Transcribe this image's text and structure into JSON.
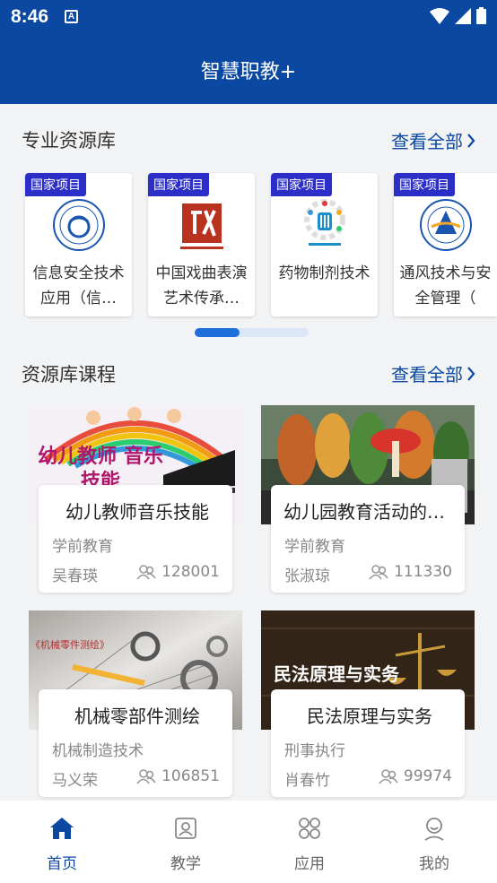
{
  "status": {
    "time": "8:46",
    "notify_letter": "A"
  },
  "header": {
    "title": "智慧职教+"
  },
  "resource_section": {
    "title": "专业资源库",
    "see_all": "查看全部",
    "items": [
      {
        "tag": "国家项目",
        "name": "信息安全技术应用（信…"
      },
      {
        "tag": "国家项目",
        "name": "中国戏曲表演艺术传承…"
      },
      {
        "tag": "国家项目",
        "name": "药物制剂技术"
      },
      {
        "tag": "国家项目",
        "name": "通风技术与安全管理（"
      }
    ]
  },
  "course_section": {
    "title": "资源库课程",
    "see_all": "查看全部",
    "courses": [
      {
        "title": "幼儿教师音乐技能",
        "category": "学前教育",
        "teacher": "吴春瑛",
        "count": "128001",
        "banner": "幼儿教师 音乐技能"
      },
      {
        "title": "幼儿园教育活动的…",
        "category": "学前教育",
        "teacher": "张淑琼",
        "count": "111330",
        "banner": ""
      },
      {
        "title": "机械零部件测绘",
        "category": "机械制造技术",
        "teacher": "马义荣",
        "count": "106851",
        "banner": "《机械零件测绘》"
      },
      {
        "title": "民法原理与实务",
        "category": "刑事执行",
        "teacher": "肖春竹",
        "count": "99974",
        "banner": "民法原理与实务"
      }
    ]
  },
  "tabbar": {
    "tabs": [
      {
        "label": "首页",
        "icon": "home-icon",
        "active": true
      },
      {
        "label": "教学",
        "icon": "teaching-icon",
        "active": false
      },
      {
        "label": "应用",
        "icon": "apps-icon",
        "active": false
      },
      {
        "label": "我的",
        "icon": "profile-icon",
        "active": false
      }
    ]
  },
  "colors": {
    "brand": "#0b48a1",
    "tag": "#2c2fc7",
    "background": "#f2f3f5"
  }
}
